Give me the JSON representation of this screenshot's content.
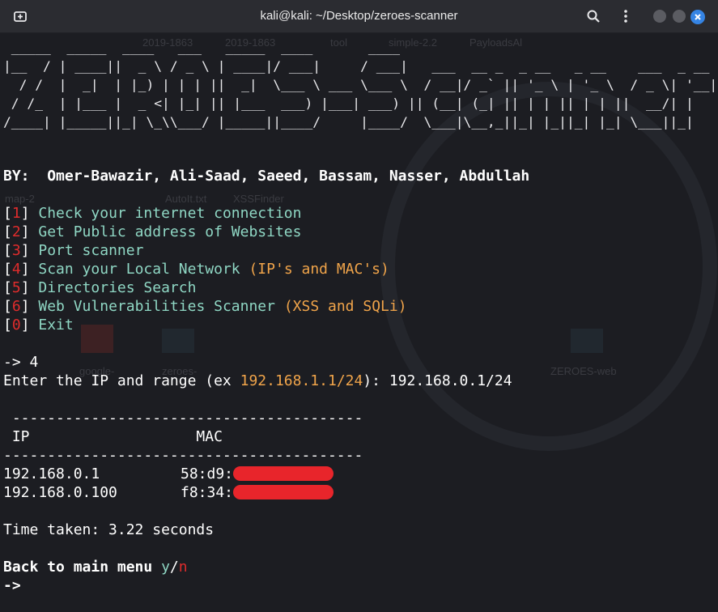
{
  "window": {
    "title": "kali@kali: ~/Desktop/zeroes-scanner",
    "icons": [
      "new-tab-icon",
      "search-icon",
      "menu-icon",
      "minimize-icon",
      "maximize-icon",
      "close-icon"
    ]
  },
  "background_items": [
    "2019-1863",
    "2019-1863",
    "tool",
    "simple-2.2",
    "PayloadsAl",
    "map-2",
    "AutoIt.txt",
    "XSSFinder",
    "google-",
    "zeroes-",
    "ZEROES-web"
  ],
  "banner": {
    "ascii_lines": [
      " _____  _____  ____   ___   _____  ____       ____                                    ",
      "|__  / | ____||  _ \\ / _ \\ | ____|/ ___|     / ___|   ___  __ _  _ __   _ __    ___  _ __ ",
      "  / /  |  _|  | |_) | | | ||  _|  \\___ \\ ___ \\___ \\  / __|/ _` || '_ \\ | '_ \\  / _ \\| '__|",
      " / /_  | |___ |  _ <| |_| || |___  ___) |___| ___) || (__| (_| || | | || | | ||  __/| |   ",
      "/____| |_____||_| \\_\\\\___/ |_____||____/     |____/  \\___|\\__,_||_| |_||_| |_| \\___||_|   "
    ]
  },
  "authors": {
    "prefix": "BY:",
    "names": "Omer-Bawazir, Ali-Saad, Saeed, Bassam, Nasser, Abdullah"
  },
  "menu": [
    {
      "num": "1",
      "label": "Check your internet connection",
      "extra": ""
    },
    {
      "num": "2",
      "label": "Get Public address of Websites",
      "extra": ""
    },
    {
      "num": "3",
      "label": "Port scanner",
      "extra": ""
    },
    {
      "num": "4",
      "label": "Scan your Local Network",
      "extra": "(IP's and MAC's)"
    },
    {
      "num": "5",
      "label": "Directories Search",
      "extra": ""
    },
    {
      "num": "6",
      "label": "Web Vulnerabilities Scanner",
      "extra": "(XSS and SQLi)"
    },
    {
      "num": "0",
      "label": "Exit",
      "extra": ""
    }
  ],
  "prompt_choice": "-> 4",
  "ip_prompt": {
    "before": "Enter the IP and range (ex ",
    "example": "192.168.1.1/24",
    "after": "): 192.168.0.1/24"
  },
  "table": {
    "rule_top": " ----------------------------------------",
    "headers": " IP                   MAC",
    "rule_bottom": "-----------------------------------------",
    "rows": [
      {
        "ip": "192.168.0.1",
        "mac_prefix": "58:d9:"
      },
      {
        "ip": "192.168.0.100",
        "mac_prefix": "f8:34:"
      }
    ]
  },
  "time_taken": "Time taken: 3.22 seconds",
  "back_prompt": {
    "text": "Back to main menu ",
    "yes": "y",
    "sep": "/",
    "no": "n"
  },
  "final_prompt": "->"
}
